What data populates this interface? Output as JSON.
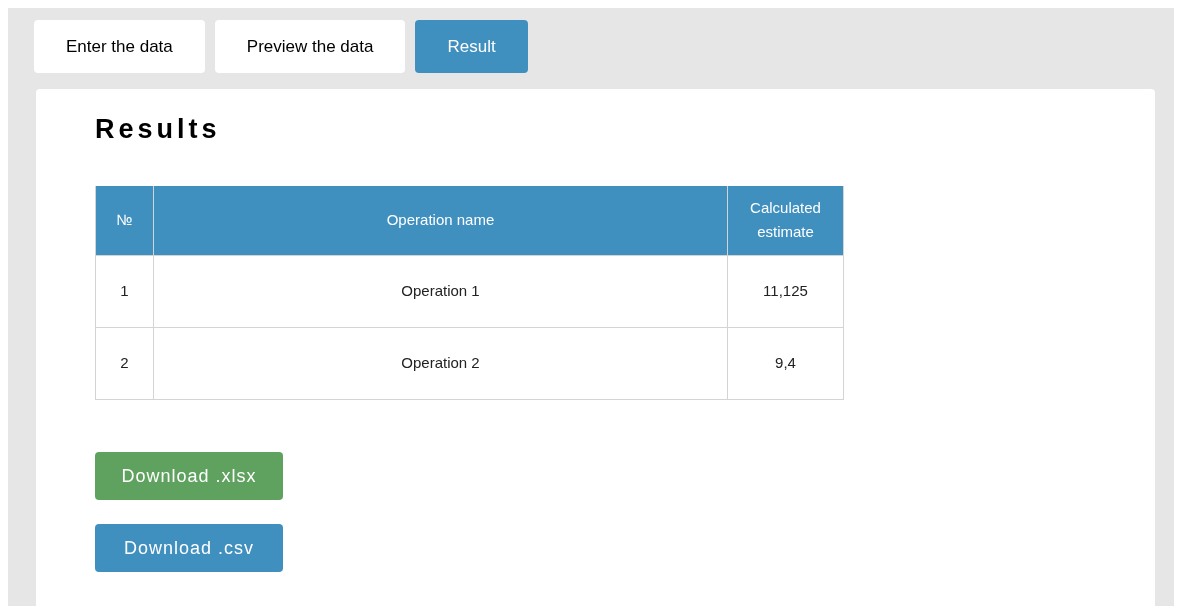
{
  "tabs": [
    {
      "label": "Enter the data",
      "selected": false
    },
    {
      "label": "Preview the data",
      "selected": false
    },
    {
      "label": "Result",
      "selected": true
    }
  ],
  "title": "Results",
  "table": {
    "columns": [
      "№",
      "Operation name",
      "Calculated estimate"
    ],
    "rows": [
      [
        "1",
        "Operation 1",
        "11,125"
      ],
      [
        "2",
        "Operation 2",
        "9,4"
      ]
    ]
  },
  "buttons": [
    {
      "label": "Download .xlsx",
      "kind": "xlsx"
    },
    {
      "label": "Download .csv",
      "kind": "csv"
    }
  ]
}
